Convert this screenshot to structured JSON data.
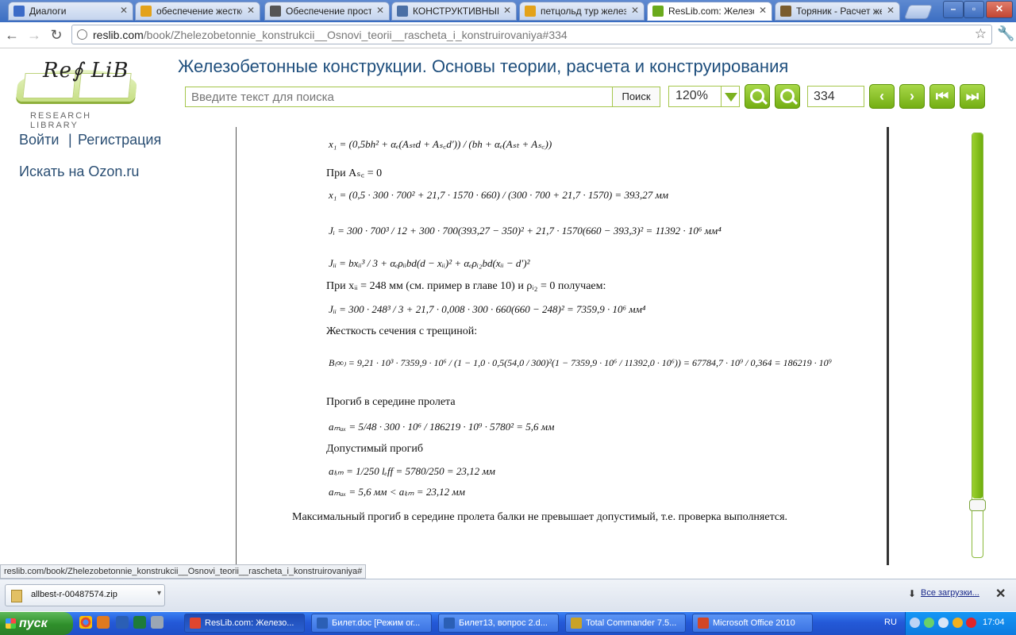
{
  "browser": {
    "tabs": [
      {
        "title": "Диалоги",
        "color": "#3c6bc7",
        "active": false
      },
      {
        "title": "обеспечение жесткос",
        "color": "#e3a21a",
        "active": false
      },
      {
        "title": "Обеспечение простра",
        "color": "#555555",
        "active": false
      },
      {
        "title": "КОНСТРУКТИВНЫЕ РЕ",
        "color": "#4a6fa5",
        "active": false
      },
      {
        "title": "петцольд тур железо",
        "color": "#e3a21a",
        "active": false
      },
      {
        "title": "ResLib.com: Железобе",
        "color": "#6aaa1c",
        "active": true
      },
      {
        "title": "Торяник - Расчет желе",
        "color": "#7a5c2e",
        "active": false
      }
    ],
    "address": {
      "domain": "reslib.com",
      "path": "/book/Zhelezobetonnie_konstrukcii__Osnovi_teorii__rascheta_i_konstruirovaniya#334"
    }
  },
  "site": {
    "logo_text": "Re∮ LiB",
    "logo_subtitle": "RESEARCH LIBRARY",
    "title": "Железобетонные конструкции. Основы теории, расчета и конструирования",
    "search": {
      "placeholder": "Введите текст для поиска",
      "button": "Поиск"
    },
    "zoom": "120%",
    "page": "334",
    "accent_color": "#7bb11f"
  },
  "sidebar": {
    "login": "Войти",
    "separator": "|",
    "register": "Регистрация",
    "ozon": "Искать на Ozon.ru"
  },
  "document": {
    "lines": [
      {
        "id": "l1",
        "text": "x₁ = (0,5bh² + αₑ(Aₛₜd + Aₛ꜀d′)) / (bh + αₑ(Aₛₜ + Aₛ꜀))"
      },
      {
        "id": "l2",
        "text": "При Aₛ꜀ = 0"
      },
      {
        "id": "l3",
        "text": "x₁ = (0,5 · 300 · 700² + 21,7 · 1570 · 660) / (300 · 700 + 21,7 · 1570) = 393,27  мм"
      },
      {
        "id": "l4",
        "text": "Jᵢ = 300 · 700³ / 12 + 300 · 700(393,27 − 350)² + 21,7 · 1570(660 − 393,3)² = 11392 · 10⁶  мм⁴"
      },
      {
        "id": "l5",
        "text": "Jᵢᵢ = bxᵢᵢ³ / 3 + αₑρᵢᵢbd(d − xᵢᵢ)² + αₑρᵢ₂bd(xᵢᵢ − d′)²"
      },
      {
        "id": "l6",
        "text": "При xᵢᵢ = 248 мм (см. пример в главе 10) и ρᵢ₂ = 0 получаем:"
      },
      {
        "id": "l7",
        "text": "Jᵢᵢ = 300 · 248³ / 3 + 21,7 · 0,008 · 300 · 660(660 − 248)² = 7359,9 · 10⁶  мм⁴"
      },
      {
        "id": "l8",
        "text": "Жесткость сечения с трещиной:"
      },
      {
        "id": "l9",
        "text": "B₍∞₎ = 9,21 · 10³ · 7359,9 · 10⁶ / (1 − 1,0 · 0,5(54,0 / 300)²(1 − 7359,9 · 10⁶ / 11392,0 · 10⁶)) = 67784,7 · 10⁹ / 0,364 = 186219 · 10⁹"
      },
      {
        "id": "l10",
        "text": "Прогиб в середине пролета"
      },
      {
        "id": "l11",
        "text": "aₘₐₓ = 5/48 · 300 · 10⁶ / 186219 · 10⁹ · 5780² = 5,6  мм"
      },
      {
        "id": "l12",
        "text": "Допустимый прогиб"
      },
      {
        "id": "l13",
        "text": "aₗᵢₘ = 1/250 lₑff = 5780/250 = 23,12  мм"
      },
      {
        "id": "l14",
        "text": "aₘₐₓ = 5,6 мм < aₗᵢₘ = 23,12 мм"
      },
      {
        "id": "l15",
        "text": "Максимальный прогиб в середине пролета балки не превышает допустимый, т.е. проверка выполняется."
      }
    ],
    "scroll_position": 0.87
  },
  "status_bar": "reslib.com/book/Zhelezobetonnie_konstrukcii__Osnovi_teorii__rascheta_i_konstruirovaniya#",
  "downloads": {
    "file": "allbest-r-00487574.zip",
    "all_label": "Все загрузки..."
  },
  "taskbar": {
    "start": "пуск",
    "items": [
      {
        "label": "ResLib.com: Железо...",
        "color": "#e0462f",
        "active": true
      },
      {
        "label": "Билет.doc [Режим ог...",
        "color": "#2b5fb5",
        "active": false
      },
      {
        "label": "Билет13, вопрос 2.d...",
        "color": "#2b5fb5",
        "active": false
      },
      {
        "label": "Total Commander 7.5...",
        "color": "#c9a227",
        "active": false
      },
      {
        "label": "Microsoft Office 2010",
        "color": "#d24726",
        "active": false
      }
    ],
    "language": "RU",
    "clock": "17:04"
  }
}
